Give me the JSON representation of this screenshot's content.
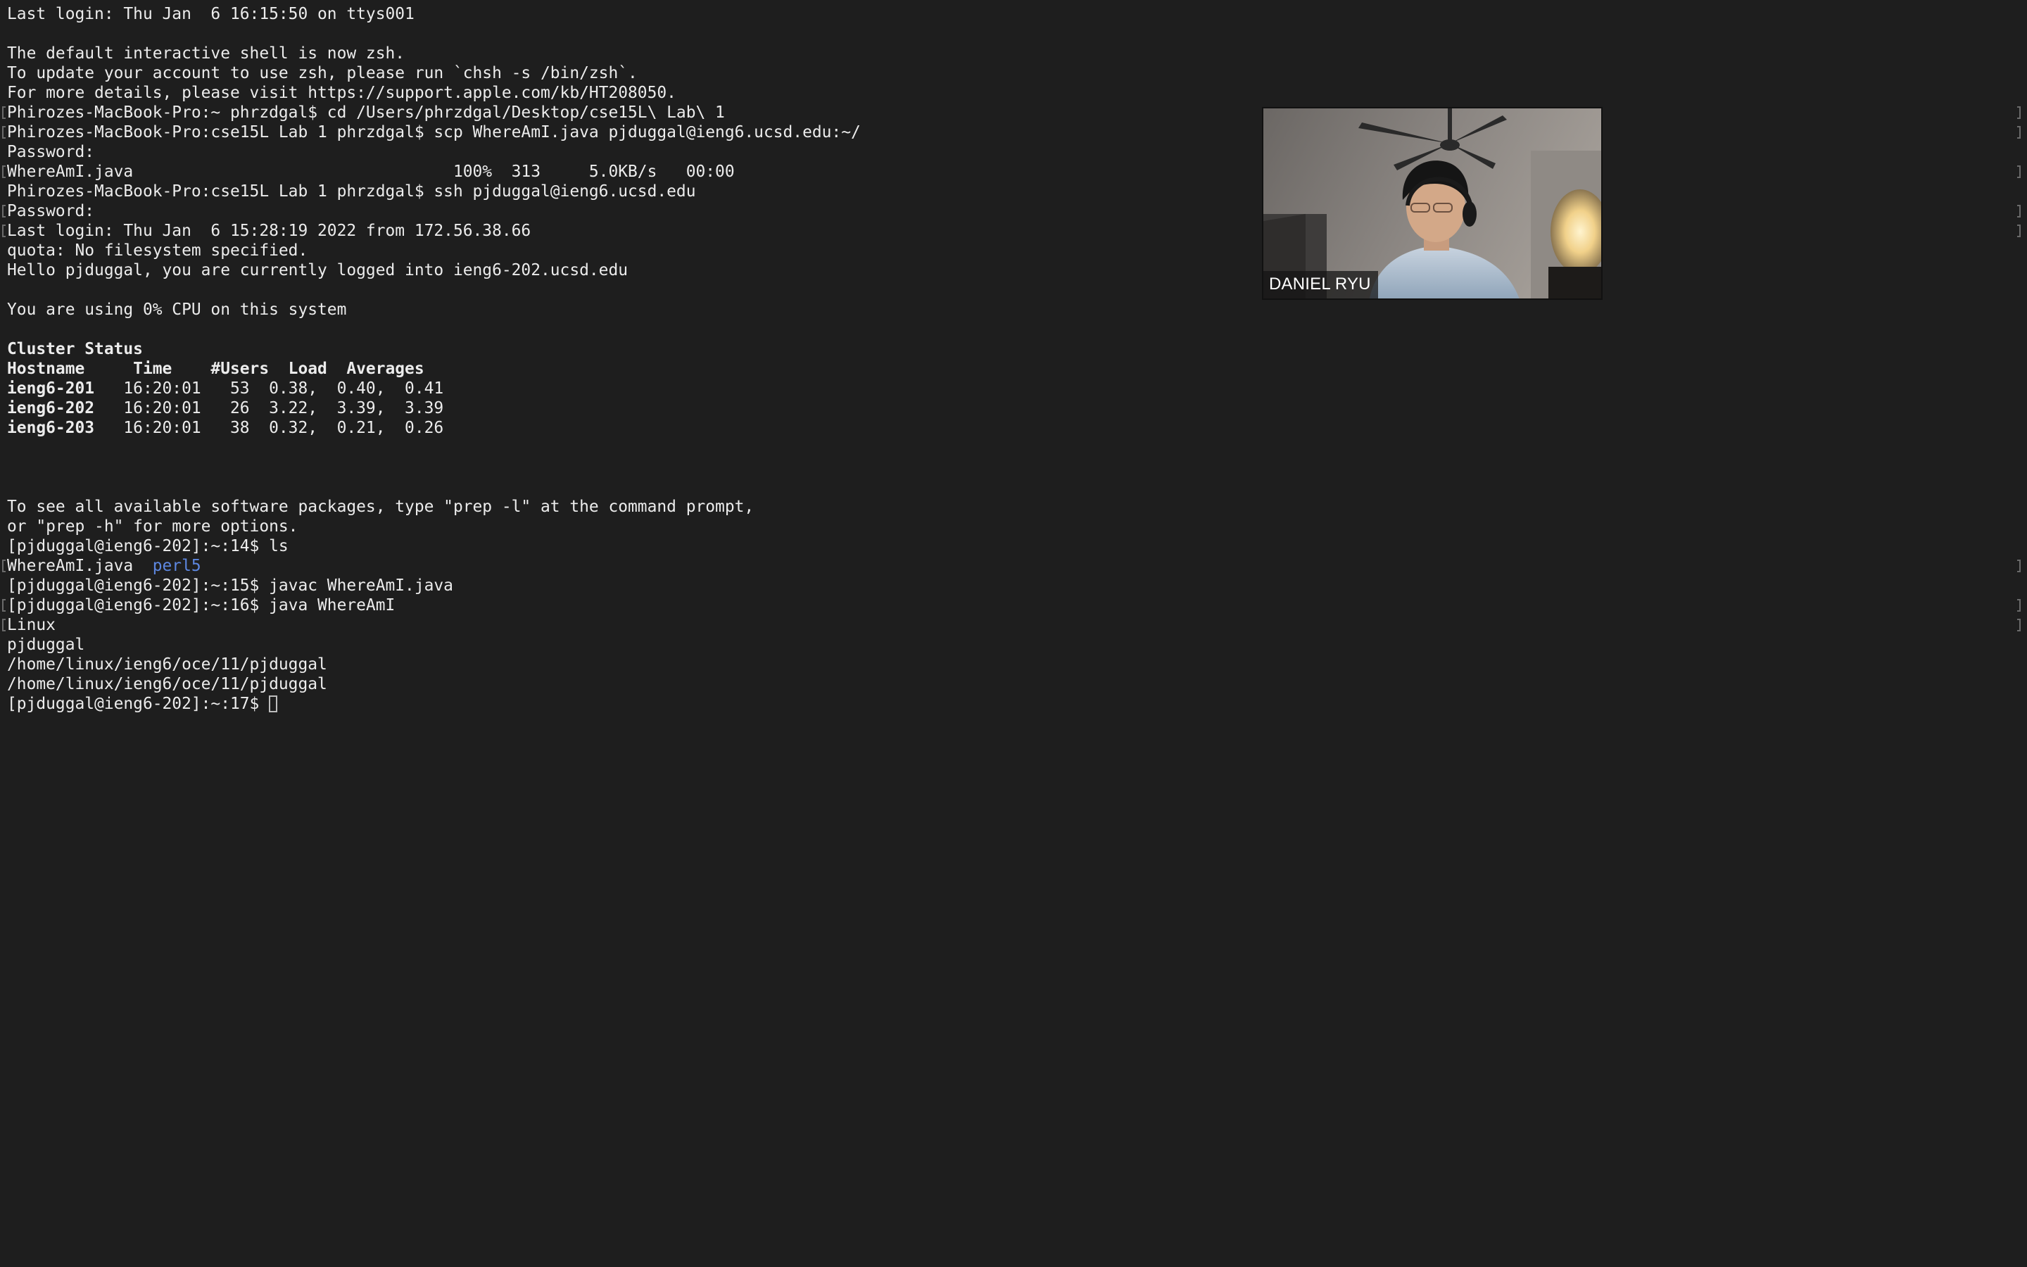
{
  "terminal": {
    "lines": [
      {
        "text": "Last login: Thu Jan  6 16:15:50 on ttys001"
      },
      {
        "text": ""
      },
      {
        "text": "The default interactive shell is now zsh."
      },
      {
        "text": "To update your account to use zsh, please run `chsh -s /bin/zsh`."
      },
      {
        "text": "For more details, please visit https://support.apple.com/kb/HT208050."
      },
      {
        "text": "Phirozes-MacBook-Pro:~ phrzdgal$ cd /Users/phrzdgal/Desktop/cse15L\\ Lab\\ 1"
      },
      {
        "text": "Phirozes-MacBook-Pro:cse15L Lab 1 phrzdgal$ scp WhereAmI.java pjduggal@ieng6.ucsd.edu:~/"
      },
      {
        "text": "Password:"
      },
      {
        "text": "WhereAmI.java                                 100%  313     5.0KB/s   00:00"
      },
      {
        "text": "Phirozes-MacBook-Pro:cse15L Lab 1 phrzdgal$ ssh pjduggal@ieng6.ucsd.edu"
      },
      {
        "text": "Password:"
      },
      {
        "text": "Last login: Thu Jan  6 15:28:19 2022 from 172.56.38.66"
      },
      {
        "text": "quota: No filesystem specified."
      },
      {
        "text": "Hello pjduggal, you are currently logged into ieng6-202.ucsd.edu"
      },
      {
        "text": ""
      },
      {
        "text": "You are using 0% CPU on this system"
      },
      {
        "text": ""
      },
      {
        "text": "Cluster Status",
        "bold": true
      },
      {
        "text": "Hostname     Time    #Users  Load  Averages",
        "bold": true
      },
      {
        "text": "ieng6-201",
        "bold": true,
        "tail": "   16:20:01   53  0.38,  0.40,  0.41"
      },
      {
        "text": "ieng6-202",
        "bold": true,
        "tail": "   16:20:01   26  3.22,  3.39,  3.39"
      },
      {
        "text": "ieng6-203",
        "bold": true,
        "tail": "   16:20:01   38  0.32,  0.21,  0.26"
      },
      {
        "text": ""
      },
      {
        "text": ""
      },
      {
        "text": ""
      },
      {
        "text": "To see all available software packages, type \"prep -l\" at the command prompt,"
      },
      {
        "text": "or \"prep -h\" for more options."
      },
      {
        "text": "[pjduggal@ieng6-202]:~:14$ ls"
      },
      {
        "text": "WhereAmI.java  ",
        "dir": "perl5"
      },
      {
        "text": "[pjduggal@ieng6-202]:~:15$ javac WhereAmI.java"
      },
      {
        "text": "[pjduggal@ieng6-202]:~:16$ java WhereAmI"
      },
      {
        "text": "Linux"
      },
      {
        "text": "pjduggal"
      },
      {
        "text": "/home/linux/ieng6/oce/11/pjduggal"
      },
      {
        "text": "/home/linux/ieng6/oce/11/pjduggal"
      },
      {
        "text": "[pjduggal@ieng6-202]:~:17$ ",
        "cursor": true
      }
    ],
    "left_marks": [
      5,
      6,
      8,
      10,
      11,
      28,
      30,
      31
    ],
    "right_marks": [
      5,
      6,
      8,
      10,
      11,
      28,
      30,
      31
    ],
    "colors": {
      "background": "#1e1e1e",
      "foreground": "#ececec",
      "directory": "#5d87e0"
    }
  },
  "video_tile": {
    "participant_name": "DANIEL RYU"
  }
}
